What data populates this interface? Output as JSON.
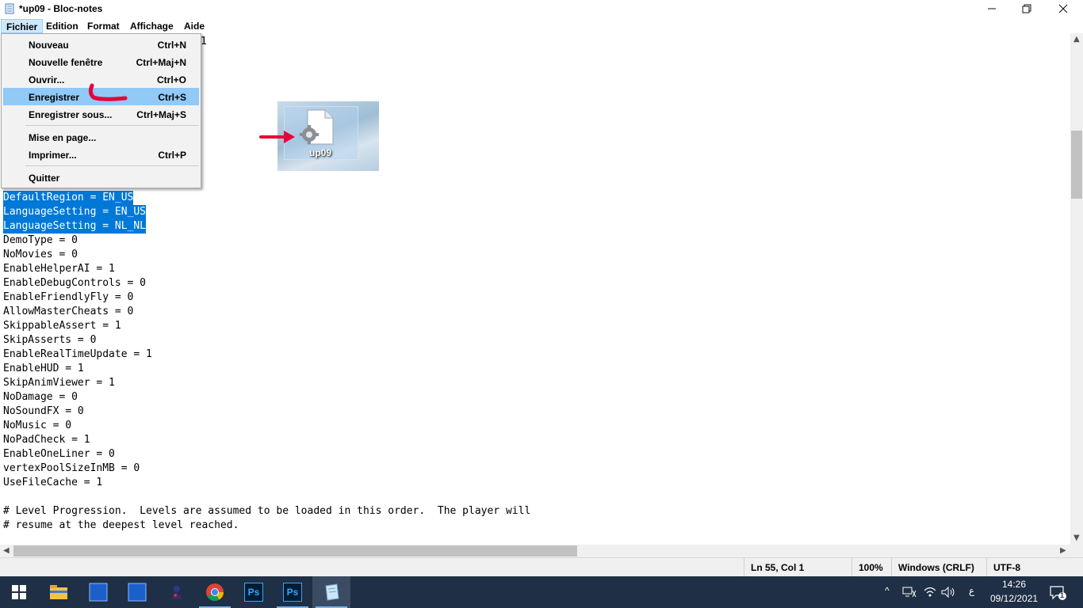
{
  "window": {
    "title": "*up09 - Bloc-notes",
    "minimize_icon": "minimize-icon",
    "maximize_icon": "restore-icon",
    "close_icon": "close-icon"
  },
  "menubar": {
    "items": [
      "Fichier",
      "Edition",
      "Format",
      "Affichage",
      "Aide"
    ]
  },
  "file_menu": {
    "items": [
      {
        "label": "Nouveau",
        "shortcut": "Ctrl+N"
      },
      {
        "label": "Nouvelle fenêtre",
        "shortcut": "Ctrl+Maj+N"
      },
      {
        "label": "Ouvrir...",
        "shortcut": "Ctrl+O"
      },
      {
        "label": "Enregistrer",
        "shortcut": "Ctrl+S"
      },
      {
        "label": "Enregistrer sous...",
        "shortcut": "Ctrl+Maj+S"
      },
      {
        "label": "Mise en page...",
        "shortcut": ""
      },
      {
        "label": "Imprimer...",
        "shortcut": "Ctrl+P"
      },
      {
        "label": "Quitter",
        "shortcut": ""
      }
    ],
    "highlighted": "Enregistrer"
  },
  "editor": {
    "top_partial": "1",
    "selected_lines": [
      "DefaultRegion = EN_US",
      "LanguageSetting = EN_US",
      "LanguageSetting = NL_NL"
    ],
    "lines": [
      "DemoType = 0",
      "NoMovies = 0",
      "EnableHelperAI = 1",
      "EnableDebugControls = 0",
      "EnableFriendlyFly = 0",
      "AllowMasterCheats = 0",
      "SkippableAssert = 1",
      "SkipAsserts = 0",
      "EnableRealTimeUpdate = 1",
      "EnableHUD = 1",
      "SkipAnimViewer = 1",
      "NoDamage = 0",
      "NoSoundFX = 0",
      "NoMusic = 0",
      "NoPadCheck = 1",
      "EnableOneLiner = 0",
      "vertexPoolSizeInMB = 0",
      "UseFileCache = 1",
      "",
      "# Level Progression.  Levels are assumed to be loaded in this order.  The player will",
      "# resume at the deepest level reached."
    ]
  },
  "overlay": {
    "file_name": "up09",
    "file_icon": "settings-file-icon",
    "arrow_icon": "red-arrow-icon"
  },
  "statusbar": {
    "position": "Ln 55, Col 1",
    "zoom": "100%",
    "line_ending": "Windows (CRLF)",
    "encoding": "UTF-8"
  },
  "taskbar": {
    "apps": [
      "start-icon",
      "file-explorer-icon",
      "app-blue-icon",
      "app-blue-icon",
      "game-icon",
      "chrome-icon",
      "photoshop-icon",
      "photoshop-icon",
      "notepad-icon"
    ],
    "ps_label": "Ps",
    "tray": {
      "chevron": "^",
      "lang": "ع",
      "time": "14:26",
      "date": "09/12/2021",
      "notifications": "1"
    }
  },
  "colors": {
    "selection": "#0078d7",
    "menu_highlight": "#91c9f7",
    "taskbar": "#1f2f45",
    "annotation": "#e8003a"
  }
}
